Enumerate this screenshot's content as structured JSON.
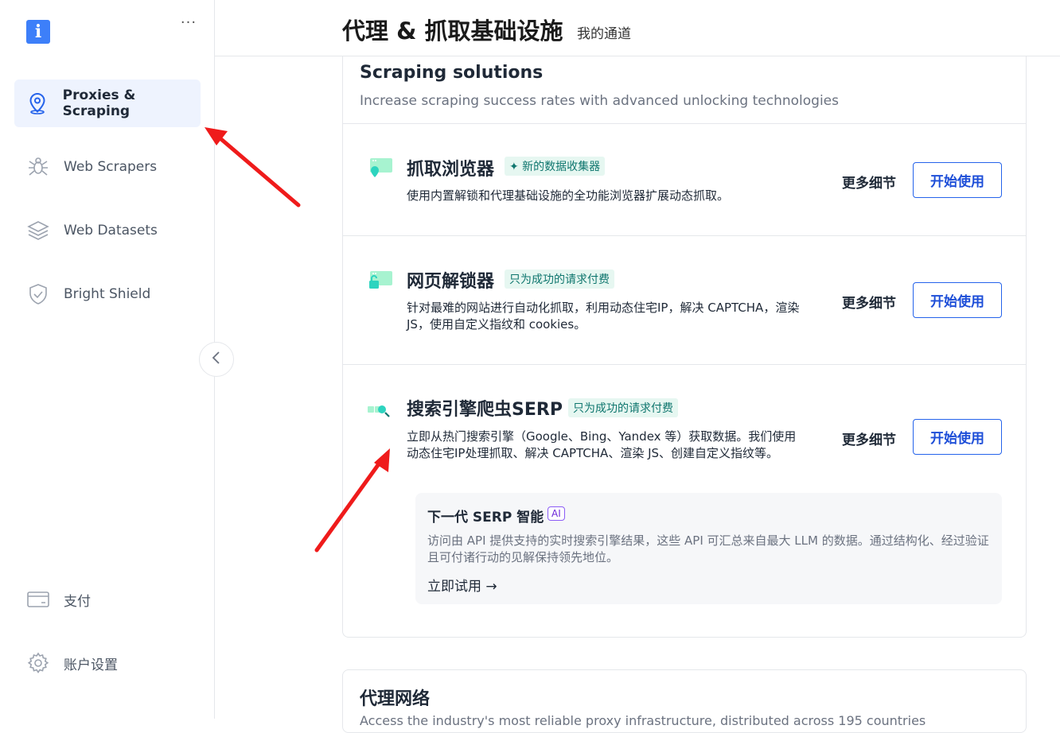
{
  "sidebar": {
    "logo_glyph": "i",
    "more": "···",
    "items": [
      {
        "label": "Proxies & Scraping",
        "icon": "location-pin-icon",
        "active": true
      },
      {
        "label": "Web Scrapers",
        "icon": "spider-icon"
      },
      {
        "label": "Web Datasets",
        "icon": "layers-icon"
      },
      {
        "label": "Bright Shield",
        "icon": "shield-icon"
      }
    ],
    "bottom_items": [
      {
        "label": "支付",
        "icon": "credit-card-icon"
      },
      {
        "label": "账户设置",
        "icon": "gear-icon"
      }
    ]
  },
  "header": {
    "title": "代理 & 抓取基础设施",
    "breadcrumb": "我的通道"
  },
  "section": {
    "title": "Scraping solutions",
    "subtitle": "Increase scraping success rates with advanced unlocking technologies"
  },
  "products": [
    {
      "name": "抓取浏览器",
      "badge": "✦ 新的数据收集器",
      "desc": "使用内置解锁和代理基础设施的全功能浏览器扩展动态抓取。",
      "more": "更多细节",
      "start": "开始使用",
      "icon": "browser-pin-icon"
    },
    {
      "name": "网页解锁器",
      "badge": "只为成功的请求付费",
      "desc": "针对最难的网站进行自动化抓取，利用动态住宅IP，解决 CAPTCHA，渲染 JS，使用自定义指纹和 cookies。",
      "more": "更多细节",
      "start": "开始使用",
      "icon": "browser-lock-icon"
    },
    {
      "name": "搜索引擎爬虫SERP",
      "badge": "只为成功的请求付费",
      "desc": "立即从热门搜索引擎（Google、Bing、Yandex 等）获取数据。我们使用动态住宅IP处理抓取、解决 CAPTCHA、渲染 JS、创建自定义指纹等。",
      "more": "更多细节",
      "start": "开始使用",
      "icon": "search-magnifier-icon"
    }
  ],
  "ai_box": {
    "title": "下一代 SERP 智能",
    "badge": "AI",
    "desc": "访问由 API 提供支持的实时搜索引擎结果，这些 API 可汇总来自最大 LLM 的数据。通过结构化、经过验证且可付诸行动的见解保持领先地位。",
    "link": "立即试用 →"
  },
  "section2": {
    "title": "代理网络",
    "subtitle": "Access the industry's most reliable proxy infrastructure, distributed across 195 countries"
  },
  "colors": {
    "accent": "#2563eb",
    "active_bg": "#eef3fe",
    "badge_green": "#0f766e",
    "arrow": "#ef1b1b"
  }
}
